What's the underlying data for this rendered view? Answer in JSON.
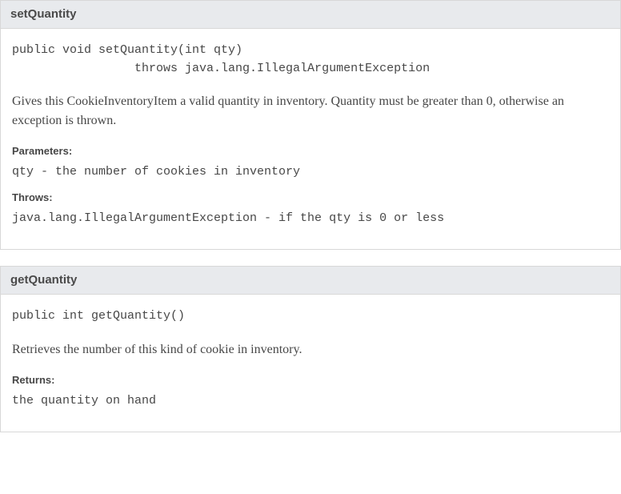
{
  "methods": [
    {
      "name": "setQuantity",
      "signature": "public void setQuantity(int qty)\n                 throws java.lang.IllegalArgumentException",
      "description": "Gives this CookieInventoryItem a valid quantity in inventory. Quantity must be greater than 0, otherwise an exception is thrown.",
      "parametersLabel": "Parameters:",
      "parameters": "qty - the number of cookies in inventory",
      "throwsLabel": "Throws:",
      "throws": "java.lang.IllegalArgumentException - if the qty is 0 or less"
    },
    {
      "name": "getQuantity",
      "signature": "public int getQuantity()",
      "description": "Retrieves the number of this kind of cookie in inventory.",
      "returnsLabel": "Returns:",
      "returns": "the quantity on hand"
    }
  ]
}
